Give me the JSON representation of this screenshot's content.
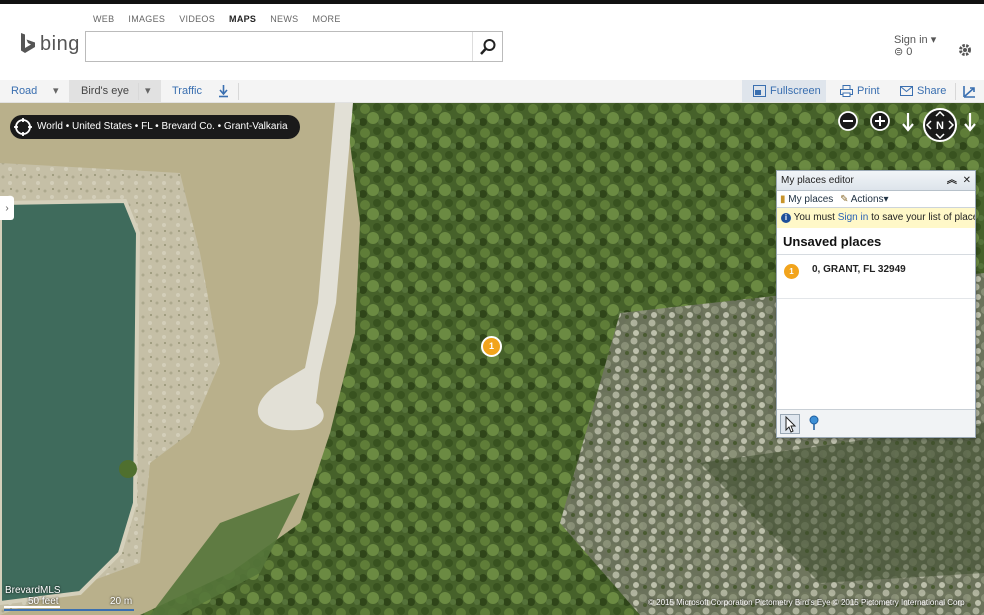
{
  "scopes": [
    "WEB",
    "IMAGES",
    "VIDEOS",
    "MAPS",
    "NEWS",
    "MORE"
  ],
  "logo_text": "bing",
  "search": {
    "value": "",
    "placeholder": ""
  },
  "account": {
    "signin": "Sign in ▾",
    "rewards": "0"
  },
  "toolbar": {
    "road": "Road",
    "birds_eye": "Bird's eye",
    "traffic": "Traffic",
    "fullscreen": "Fullscreen",
    "print": "Print",
    "share": "Share"
  },
  "breadcrumb": "World • United States • FL • Brevard Co. • Grant-Valkaria",
  "map_pin": "1",
  "panel": {
    "title": "My places editor",
    "tab_my_places": "My places",
    "tab_actions": "Actions▾",
    "warn_prefix": "You must ",
    "warn_link": "Sign in",
    "warn_suffix": " to save your list of places",
    "section_title": "Unsaved places",
    "places": [
      {
        "number": "1",
        "address": "0, GRANT, FL 32949"
      }
    ]
  },
  "scale": {
    "source": "BrevardMLS",
    "feet": "50 feet",
    "meters": "20 m"
  },
  "copyright": "© 2015 Microsoft Corporation    Pictometry Bird's Eye © 2015 Pictometry International Corp",
  "colors": {
    "accent": "#3a6fb0",
    "pin": "#f2a41c",
    "water": "#3f6b5c",
    "vegetation": "#3f5a23"
  }
}
